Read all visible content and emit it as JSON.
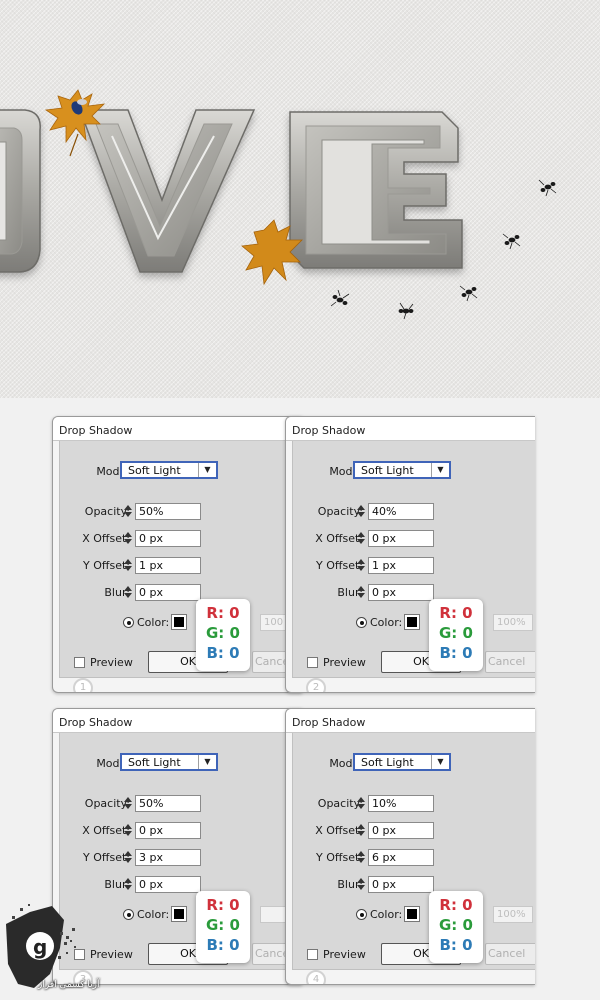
{
  "artwork": {
    "word_visible": "OVE",
    "icons": [
      "maple-leaf-icon",
      "ant-icon",
      "bee-icon"
    ]
  },
  "dialogs": [
    {
      "title": "Drop Shadow",
      "step": "1",
      "mode_label": "Mode:",
      "mode_value": "Soft Light",
      "opacity_label": "Opacity:",
      "opacity_value": "50%",
      "x_offset_label": "X Offset:",
      "x_offset_value": "0 px",
      "y_offset_label": "Y Offset:",
      "y_offset_value": "1 px",
      "blur_label": "Blur:",
      "blur_value": "0 px",
      "color_label": "Color:",
      "ghost_value": "100",
      "preview_label": "Preview",
      "ok_label": "OK",
      "cancel_label": "Cancel",
      "rgb": {
        "r": "R: 0",
        "g": "G: 0",
        "b": "B: 0"
      }
    },
    {
      "title": "Drop Shadow",
      "step": "2",
      "mode_label": "Mode:",
      "mode_value": "Soft Light",
      "opacity_label": "Opacity:",
      "opacity_value": "40%",
      "x_offset_label": "X Offset:",
      "x_offset_value": "0 px",
      "y_offset_label": "Y Offset:",
      "y_offset_value": "1 px",
      "blur_label": "Blur:",
      "blur_value": "0 px",
      "color_label": "Color:",
      "ghost_value": "100%",
      "preview_label": "Preview",
      "ok_label": "OK",
      "cancel_label": "Cancel",
      "rgb": {
        "r": "R: 0",
        "g": "G: 0",
        "b": "B: 0"
      }
    },
    {
      "title": "Drop Shadow",
      "step": "3",
      "mode_label": "Mode:",
      "mode_value": "Soft Light",
      "opacity_label": "Opacity:",
      "opacity_value": "50%",
      "x_offset_label": "X Offset:",
      "x_offset_value": "0 px",
      "y_offset_label": "Y Offset:",
      "y_offset_value": "3 px",
      "blur_label": "Blur:",
      "blur_value": "0 px",
      "color_label": "Color:",
      "ghost_value": "",
      "preview_label": "Preview",
      "ok_label": "OK",
      "cancel_label": "Cance",
      "rgb": {
        "r": "R: 0",
        "g": "G: 0",
        "b": "B: 0"
      }
    },
    {
      "title": "Drop Shadow",
      "step": "4",
      "mode_label": "Mode:",
      "mode_value": "Soft Light",
      "opacity_label": "Opacity:",
      "opacity_value": "10%",
      "x_offset_label": "X Offset:",
      "x_offset_value": "0 px",
      "y_offset_label": "Y Offset:",
      "y_offset_value": "6 px",
      "blur_label": "Blur:",
      "blur_value": "0 px",
      "color_label": "Color:",
      "ghost_value": "100%",
      "preview_label": "Preview",
      "ok_label": "OK",
      "cancel_label": "Cancel",
      "rgb": {
        "r": "R: 0",
        "g": "G: 0",
        "b": "B: 0"
      }
    }
  ],
  "watermark": {
    "text": "آرنا کسمی افزار"
  },
  "colors": {
    "select_border": "#3f64b8",
    "rgb_r": "#d0313b",
    "rgb_g": "#2a9b3b",
    "rgb_b": "#2d7bb6"
  }
}
